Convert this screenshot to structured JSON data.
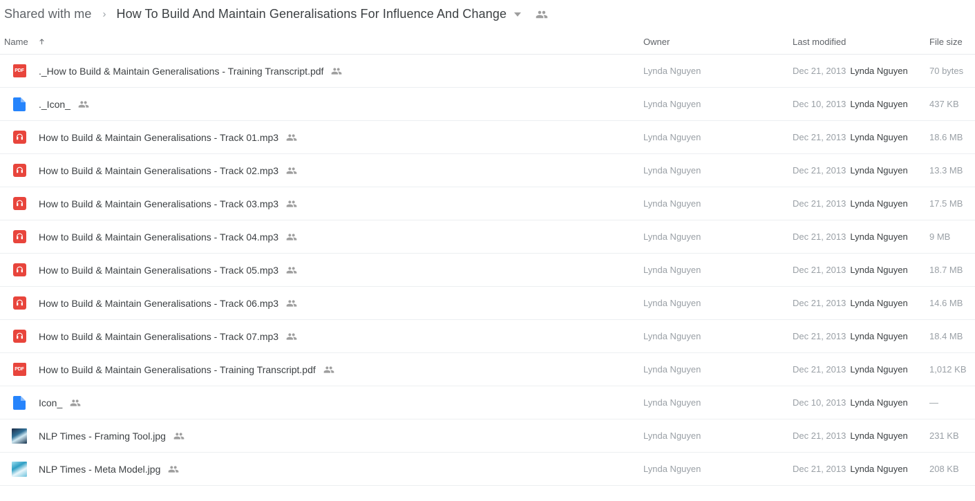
{
  "breadcrumb": {
    "root": "Shared with me",
    "separator": "›",
    "current": "How To Build And Maintain Generalisations For Influence And Change",
    "dropdown_icon": "chevron-down-icon",
    "people_icon": "people-icon"
  },
  "columns": {
    "name": "Name",
    "owner": "Owner",
    "modified": "Last modified",
    "size": "File size",
    "sort_direction": "ascending",
    "sort_icon": "arrow-up-icon"
  },
  "colors": {
    "pdf_red": "#e8453c",
    "audio_red": "#e8453c",
    "doc_blue": "#2684fc",
    "text_primary": "#3c4043",
    "text_secondary": "#9aa0a6",
    "divider": "#eceff1"
  },
  "files": [
    {
      "name": "._How to Build & Maintain Generalisations - Training Transcript.pdf",
      "icon": "pdf-file-icon",
      "icon_label": "PDF",
      "shared": true,
      "owner": "Lynda Nguyen",
      "modified_date": "Dec 21, 2013",
      "modified_by": "Lynda Nguyen",
      "size": "70 bytes"
    },
    {
      "name": "._Icon_",
      "icon": "generic-file-icon",
      "shared": true,
      "owner": "Lynda Nguyen",
      "modified_date": "Dec 10, 2013",
      "modified_by": "Lynda Nguyen",
      "size": "437 KB"
    },
    {
      "name": "How to Build & Maintain Generalisations - Track 01.mp3",
      "icon": "audio-file-icon",
      "shared": true,
      "owner": "Lynda Nguyen",
      "modified_date": "Dec 21, 2013",
      "modified_by": "Lynda Nguyen",
      "size": "18.6 MB"
    },
    {
      "name": "How to Build & Maintain Generalisations - Track 02.mp3",
      "icon": "audio-file-icon",
      "shared": true,
      "owner": "Lynda Nguyen",
      "modified_date": "Dec 21, 2013",
      "modified_by": "Lynda Nguyen",
      "size": "13.3 MB"
    },
    {
      "name": "How to Build & Maintain Generalisations - Track 03.mp3",
      "icon": "audio-file-icon",
      "shared": true,
      "owner": "Lynda Nguyen",
      "modified_date": "Dec 21, 2013",
      "modified_by": "Lynda Nguyen",
      "size": "17.5 MB"
    },
    {
      "name": "How to Build & Maintain Generalisations - Track 04.mp3",
      "icon": "audio-file-icon",
      "shared": true,
      "owner": "Lynda Nguyen",
      "modified_date": "Dec 21, 2013",
      "modified_by": "Lynda Nguyen",
      "size": "9 MB"
    },
    {
      "name": "How to Build & Maintain Generalisations - Track 05.mp3",
      "icon": "audio-file-icon",
      "shared": true,
      "owner": "Lynda Nguyen",
      "modified_date": "Dec 21, 2013",
      "modified_by": "Lynda Nguyen",
      "size": "18.7 MB"
    },
    {
      "name": "How to Build & Maintain Generalisations - Track 06.mp3",
      "icon": "audio-file-icon",
      "shared": true,
      "owner": "Lynda Nguyen",
      "modified_date": "Dec 21, 2013",
      "modified_by": "Lynda Nguyen",
      "size": "14.6 MB"
    },
    {
      "name": "How to Build & Maintain Generalisations - Track 07.mp3",
      "icon": "audio-file-icon",
      "shared": true,
      "owner": "Lynda Nguyen",
      "modified_date": "Dec 21, 2013",
      "modified_by": "Lynda Nguyen",
      "size": "18.4 MB"
    },
    {
      "name": "How to Build & Maintain Generalisations - Training Transcript.pdf",
      "icon": "pdf-file-icon",
      "icon_label": "PDF",
      "shared": true,
      "owner": "Lynda Nguyen",
      "modified_date": "Dec 21, 2013",
      "modified_by": "Lynda Nguyen",
      "size": "1,012 KB"
    },
    {
      "name": "Icon_",
      "icon": "generic-file-icon",
      "shared": true,
      "owner": "Lynda Nguyen",
      "modified_date": "Dec 10, 2013",
      "modified_by": "Lynda Nguyen",
      "size": "—"
    },
    {
      "name": "NLP Times - Framing Tool.jpg",
      "icon": "image-thumbnail",
      "thumb": "dark-blue",
      "shared": true,
      "owner": "Lynda Nguyen",
      "modified_date": "Dec 21, 2013",
      "modified_by": "Lynda Nguyen",
      "size": "231 KB"
    },
    {
      "name": "NLP Times - Meta Model.jpg",
      "icon": "image-thumbnail",
      "thumb": "cyan",
      "shared": true,
      "owner": "Lynda Nguyen",
      "modified_date": "Dec 21, 2013",
      "modified_by": "Lynda Nguyen",
      "size": "208 KB"
    }
  ]
}
